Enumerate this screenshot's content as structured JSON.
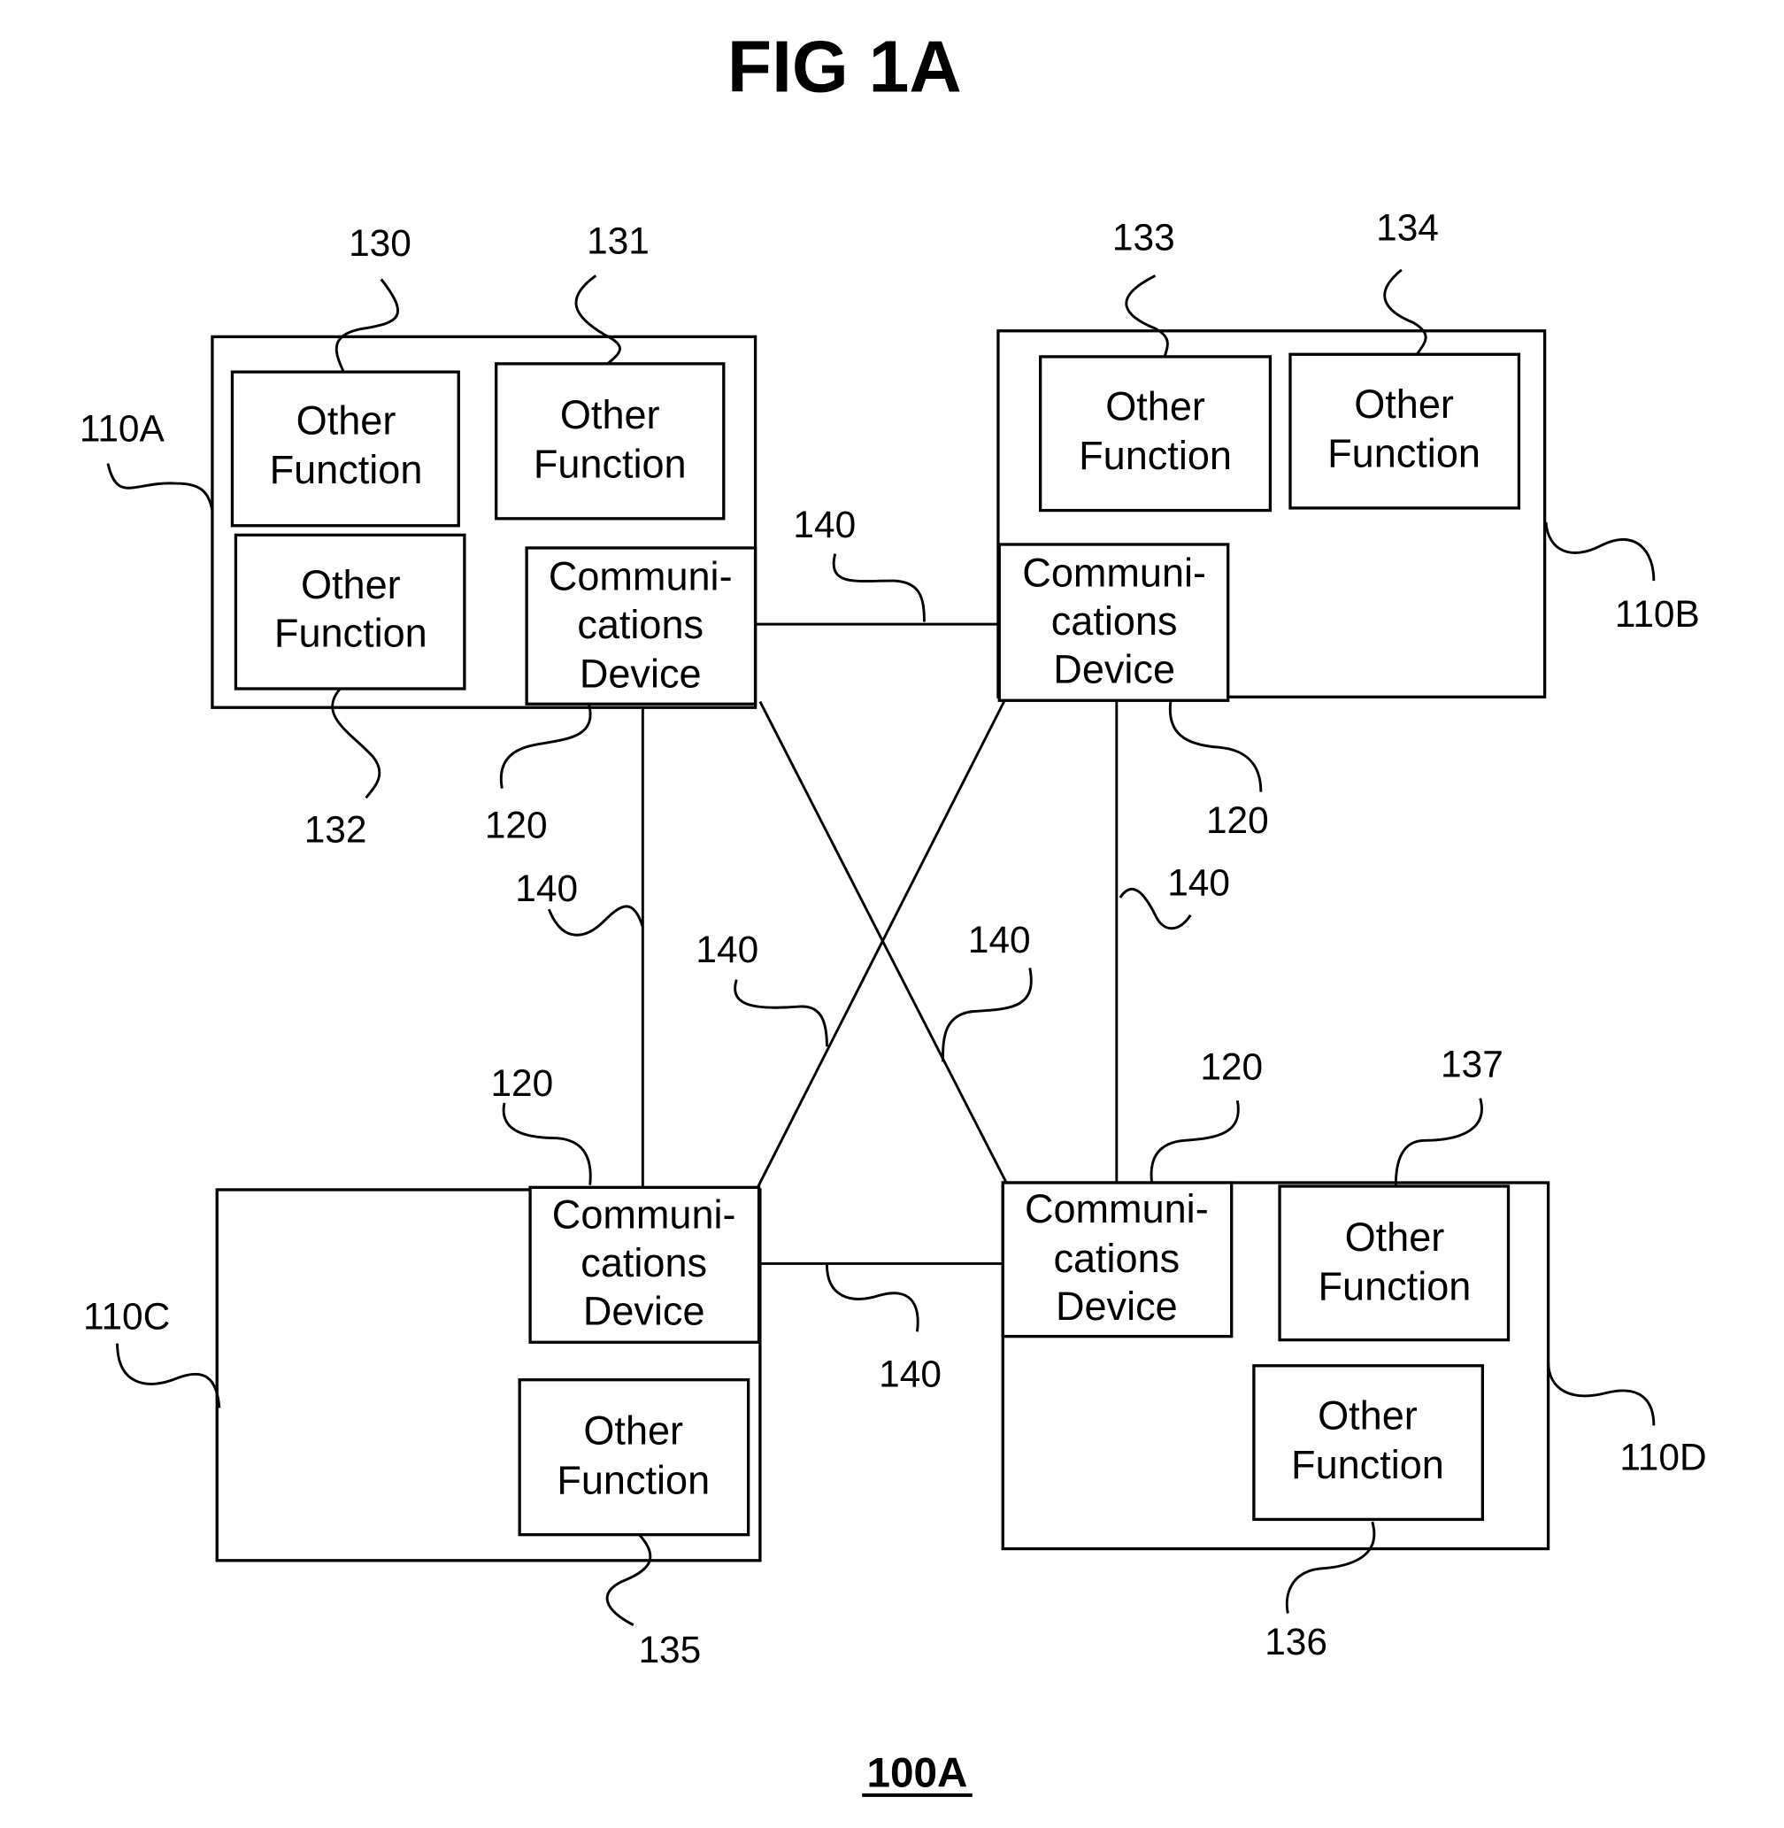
{
  "title": "FIG 1A",
  "caption": "100A",
  "function_label": [
    "Other",
    "Function"
  ],
  "comm_label": [
    "Communi-",
    "cations",
    "Device"
  ],
  "nodes": {
    "a": "110A",
    "b": "110B",
    "c": "110C",
    "d": "110D"
  },
  "refs": {
    "f130": "130",
    "f131": "131",
    "f132": "132",
    "f133": "133",
    "f134": "134",
    "f135": "135",
    "f136": "136",
    "f137": "137",
    "comm": "120",
    "link": "140"
  }
}
